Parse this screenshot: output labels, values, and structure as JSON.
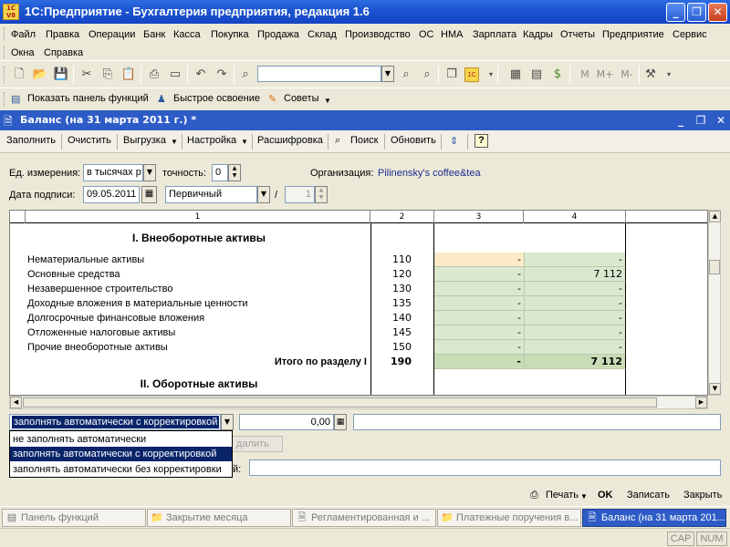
{
  "window": {
    "title": "1С:Предприятие - Бухгалтерия предприятия, редакция 1.6",
    "app_icon": "1c-app-icon",
    "app_icon_text": "1C V8"
  },
  "menu": [
    "Файл",
    "Правка",
    "Операции",
    "Банк",
    "Касса",
    "Покупка",
    "Продажа",
    "Склад",
    "Производство",
    "ОС",
    "НМА",
    "Зарплата",
    "Кадры",
    "Отчеты",
    "Предприятие",
    "Сервис",
    "Окна",
    "Справка"
  ],
  "toolbar": {
    "search_value": "",
    "m_labels": [
      "M",
      "M+",
      "M-"
    ]
  },
  "quickbar": {
    "panel": "Показать панель функций",
    "learn": "Быстрое освоение",
    "tips": "Советы"
  },
  "document": {
    "title": "Баланс (на 31 марта 2011 г.) *"
  },
  "doctoolbar": {
    "fill": "Заполнить",
    "clear": "Очистить",
    "export": "Выгрузка",
    "settings": "Настройка",
    "decode": "Расшифровка",
    "search": "Поиск",
    "refresh": "Обновить",
    "help": "?"
  },
  "form": {
    "units_label": "Ед. измерения:",
    "units_value": "в тысячах р",
    "precision_label": "точность:",
    "precision_value": "0",
    "org_label": "Организация:",
    "org_value": "Pilinensky's coffee&tea",
    "date_label": "Дата подписи:",
    "date_value": "09.05.2011",
    "type_value": "Первичный",
    "slash": "/",
    "corr_value": "1"
  },
  "grid": {
    "headers": [
      "1",
      "2",
      "3",
      "4"
    ],
    "rows": [
      {
        "kind": "sect",
        "name": "I. Внеоборотные активы",
        "code": "",
        "c3": "",
        "c4": ""
      },
      {
        "kind": "row",
        "name": "Нематериальные активы",
        "code": "110",
        "c3": "-",
        "c4": "-",
        "hl": true
      },
      {
        "kind": "row",
        "name": "Основные средства",
        "code": "120",
        "c3": "-",
        "c4": "7 112"
      },
      {
        "kind": "row",
        "name": "Незавершенное строительство",
        "code": "130",
        "c3": "-",
        "c4": "-"
      },
      {
        "kind": "row",
        "name": "Доходные вложения в материальные ценности",
        "code": "135",
        "c3": "-",
        "c4": "-"
      },
      {
        "kind": "row",
        "name": "Долгосрочные финансовые вложения",
        "code": "140",
        "c3": "-",
        "c4": "-"
      },
      {
        "kind": "row",
        "name": "Отложенные налоговые активы",
        "code": "145",
        "c3": "-",
        "c4": "-"
      },
      {
        "kind": "row",
        "name": "Прочие внеоборотные активы",
        "code": "150",
        "c3": "-",
        "c4": "-"
      },
      {
        "kind": "total",
        "name": "Итого по разделу I",
        "code": "190",
        "c3": "-",
        "c4": "7 112"
      },
      {
        "kind": "sect",
        "name": "II. Оборотные активы",
        "code": "",
        "c3": "",
        "c4": ""
      }
    ]
  },
  "bottom": {
    "mode_selected": "заполнять автоматически с корректировкой",
    "amount": "0,00",
    "options": [
      "не заполнять автоматически",
      "заполнять автоматически с корректировкой",
      "заполнять автоматически без корректировки"
    ],
    "delete_label": "далить",
    "comment_suffix": "й:"
  },
  "actions": {
    "print": "Печать",
    "ok": "OK",
    "save": "Записать",
    "close": "Закрыть"
  },
  "taskbar": [
    {
      "label": "Панель функций",
      "active": false
    },
    {
      "label": "Закрытие месяца",
      "active": false
    },
    {
      "label": "Регламентированная и ...",
      "active": false
    },
    {
      "label": "Платежные поручения в...",
      "active": false
    },
    {
      "label": "Баланс (на 31 марта 201...",
      "active": true
    }
  ],
  "status": {
    "cap": "CAP",
    "num": "NUM"
  }
}
